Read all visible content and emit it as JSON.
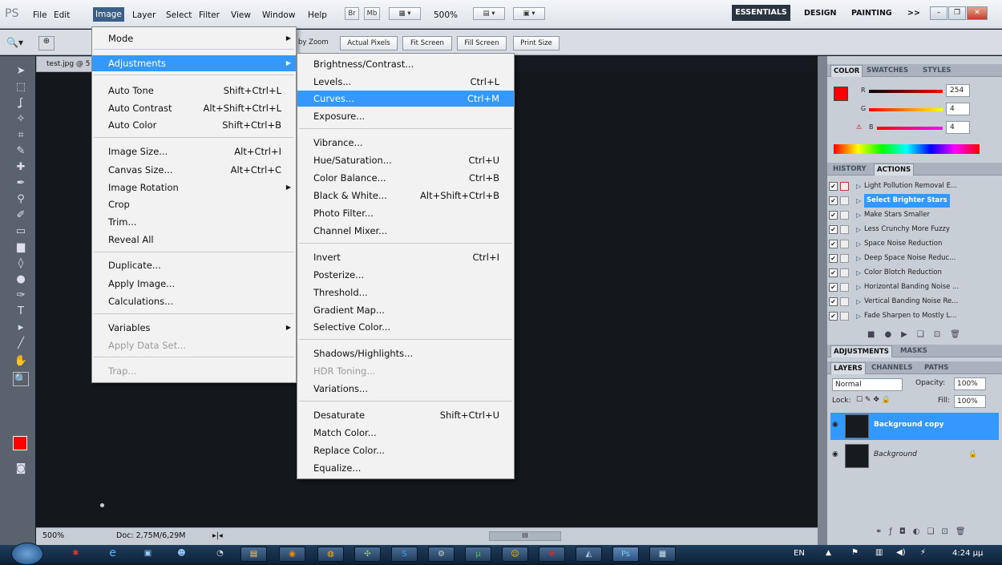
{
  "menubar": {
    "logo": "PS",
    "items": [
      "File",
      "Edit",
      "Image",
      "Layer",
      "Select",
      "Filter",
      "View",
      "Window",
      "Help"
    ],
    "br": "Br",
    "mb": "Mb",
    "zoom": "500%",
    "workspaces": [
      "ESSENTIALS",
      "DESIGN",
      "PAINTING",
      ">>"
    ]
  },
  "options": {
    "zoom_prefix": "by Zoom",
    "buttons": [
      "Actual Pixels",
      "Fit Screen",
      "Fill Screen",
      "Print Size"
    ]
  },
  "document": {
    "tab": "test.jpg @ 5",
    "zoom": "500%",
    "doc_info": "Doc: 2,75M/6,29M",
    "scroll_mark": "III"
  },
  "image_menu": {
    "items": [
      {
        "label": "Mode",
        "shortcut": ""
      },
      {
        "label": "Adjustments",
        "shortcut": ""
      },
      {
        "label": "Auto Tone",
        "shortcut": "Shift+Ctrl+L"
      },
      {
        "label": "Auto Contrast",
        "shortcut": "Alt+Shift+Ctrl+L"
      },
      {
        "label": "Auto Color",
        "shortcut": "Shift+Ctrl+B"
      },
      {
        "label": "Image Size...",
        "shortcut": "Alt+Ctrl+I"
      },
      {
        "label": "Canvas Size...",
        "shortcut": "Alt+Ctrl+C"
      },
      {
        "label": "Image Rotation",
        "shortcut": ""
      },
      {
        "label": "Crop",
        "shortcut": ""
      },
      {
        "label": "Trim...",
        "shortcut": ""
      },
      {
        "label": "Reveal All",
        "shortcut": ""
      },
      {
        "label": "Duplicate...",
        "shortcut": ""
      },
      {
        "label": "Apply Image...",
        "shortcut": ""
      },
      {
        "label": "Calculations...",
        "shortcut": ""
      },
      {
        "label": "Variables",
        "shortcut": ""
      },
      {
        "label": "Apply Data Set...",
        "shortcut": ""
      },
      {
        "label": "Trap...",
        "shortcut": ""
      }
    ]
  },
  "adjust_menu": {
    "items": [
      {
        "label": "Brightness/Contrast...",
        "shortcut": ""
      },
      {
        "label": "Levels...",
        "shortcut": "Ctrl+L"
      },
      {
        "label": "Curves...",
        "shortcut": "Ctrl+M"
      },
      {
        "label": "Exposure...",
        "shortcut": ""
      },
      {
        "label": "Vibrance...",
        "shortcut": ""
      },
      {
        "label": "Hue/Saturation...",
        "shortcut": "Ctrl+U"
      },
      {
        "label": "Color Balance...",
        "shortcut": "Ctrl+B"
      },
      {
        "label": "Black & White...",
        "shortcut": "Alt+Shift+Ctrl+B"
      },
      {
        "label": "Photo Filter...",
        "shortcut": ""
      },
      {
        "label": "Channel Mixer...",
        "shortcut": ""
      },
      {
        "label": "Invert",
        "shortcut": "Ctrl+I"
      },
      {
        "label": "Posterize...",
        "shortcut": ""
      },
      {
        "label": "Threshold...",
        "shortcut": ""
      },
      {
        "label": "Gradient Map...",
        "shortcut": ""
      },
      {
        "label": "Selective Color...",
        "shortcut": ""
      },
      {
        "label": "Shadows/Highlights...",
        "shortcut": ""
      },
      {
        "label": "HDR Toning...",
        "shortcut": ""
      },
      {
        "label": "Variations...",
        "shortcut": ""
      },
      {
        "label": "Desaturate",
        "shortcut": "Shift+Ctrl+U"
      },
      {
        "label": "Match Color...",
        "shortcut": ""
      },
      {
        "label": "Replace Color...",
        "shortcut": ""
      },
      {
        "label": "Equalize...",
        "shortcut": ""
      }
    ]
  },
  "color_panel": {
    "tabs": [
      "COLOR",
      "SWATCHES",
      "STYLES"
    ],
    "r": "254",
    "g": "4",
    "b": "4",
    "r_label": "R",
    "g_label": "G",
    "b_label": "B"
  },
  "actions_panel": {
    "tabs": [
      "HISTORY",
      "ACTIONS"
    ],
    "items": [
      "Light Pollution Removal E...",
      "Select Brighter Stars",
      "Make Stars Smaller",
      "Less Crunchy More Fuzzy",
      "Space Noise Reduction",
      "Deep Space Noise Reduc...",
      "Color Blotch Reduction",
      "Horizontal Banding Noise ...",
      "Vertical Banding Noise Re...",
      "Fade Sharpen to Mostly L..."
    ]
  },
  "adjust_panel": {
    "tabs": [
      "ADJUSTMENTS",
      "MASKS"
    ]
  },
  "layers_panel": {
    "tabs": [
      "LAYERS",
      "CHANNELS",
      "PATHS"
    ],
    "blend": "Normal",
    "opacity_label": "Opacity:",
    "opacity": "100%",
    "lock_label": "Lock:",
    "fill_label": "Fill:",
    "fill": "100%",
    "layers": [
      "Background copy",
      "Background"
    ]
  },
  "taskbar": {
    "lang": "EN",
    "time": "4:24 μμ"
  },
  "colors": {
    "accent": "#3399ff",
    "foreground": "#ff0000"
  }
}
